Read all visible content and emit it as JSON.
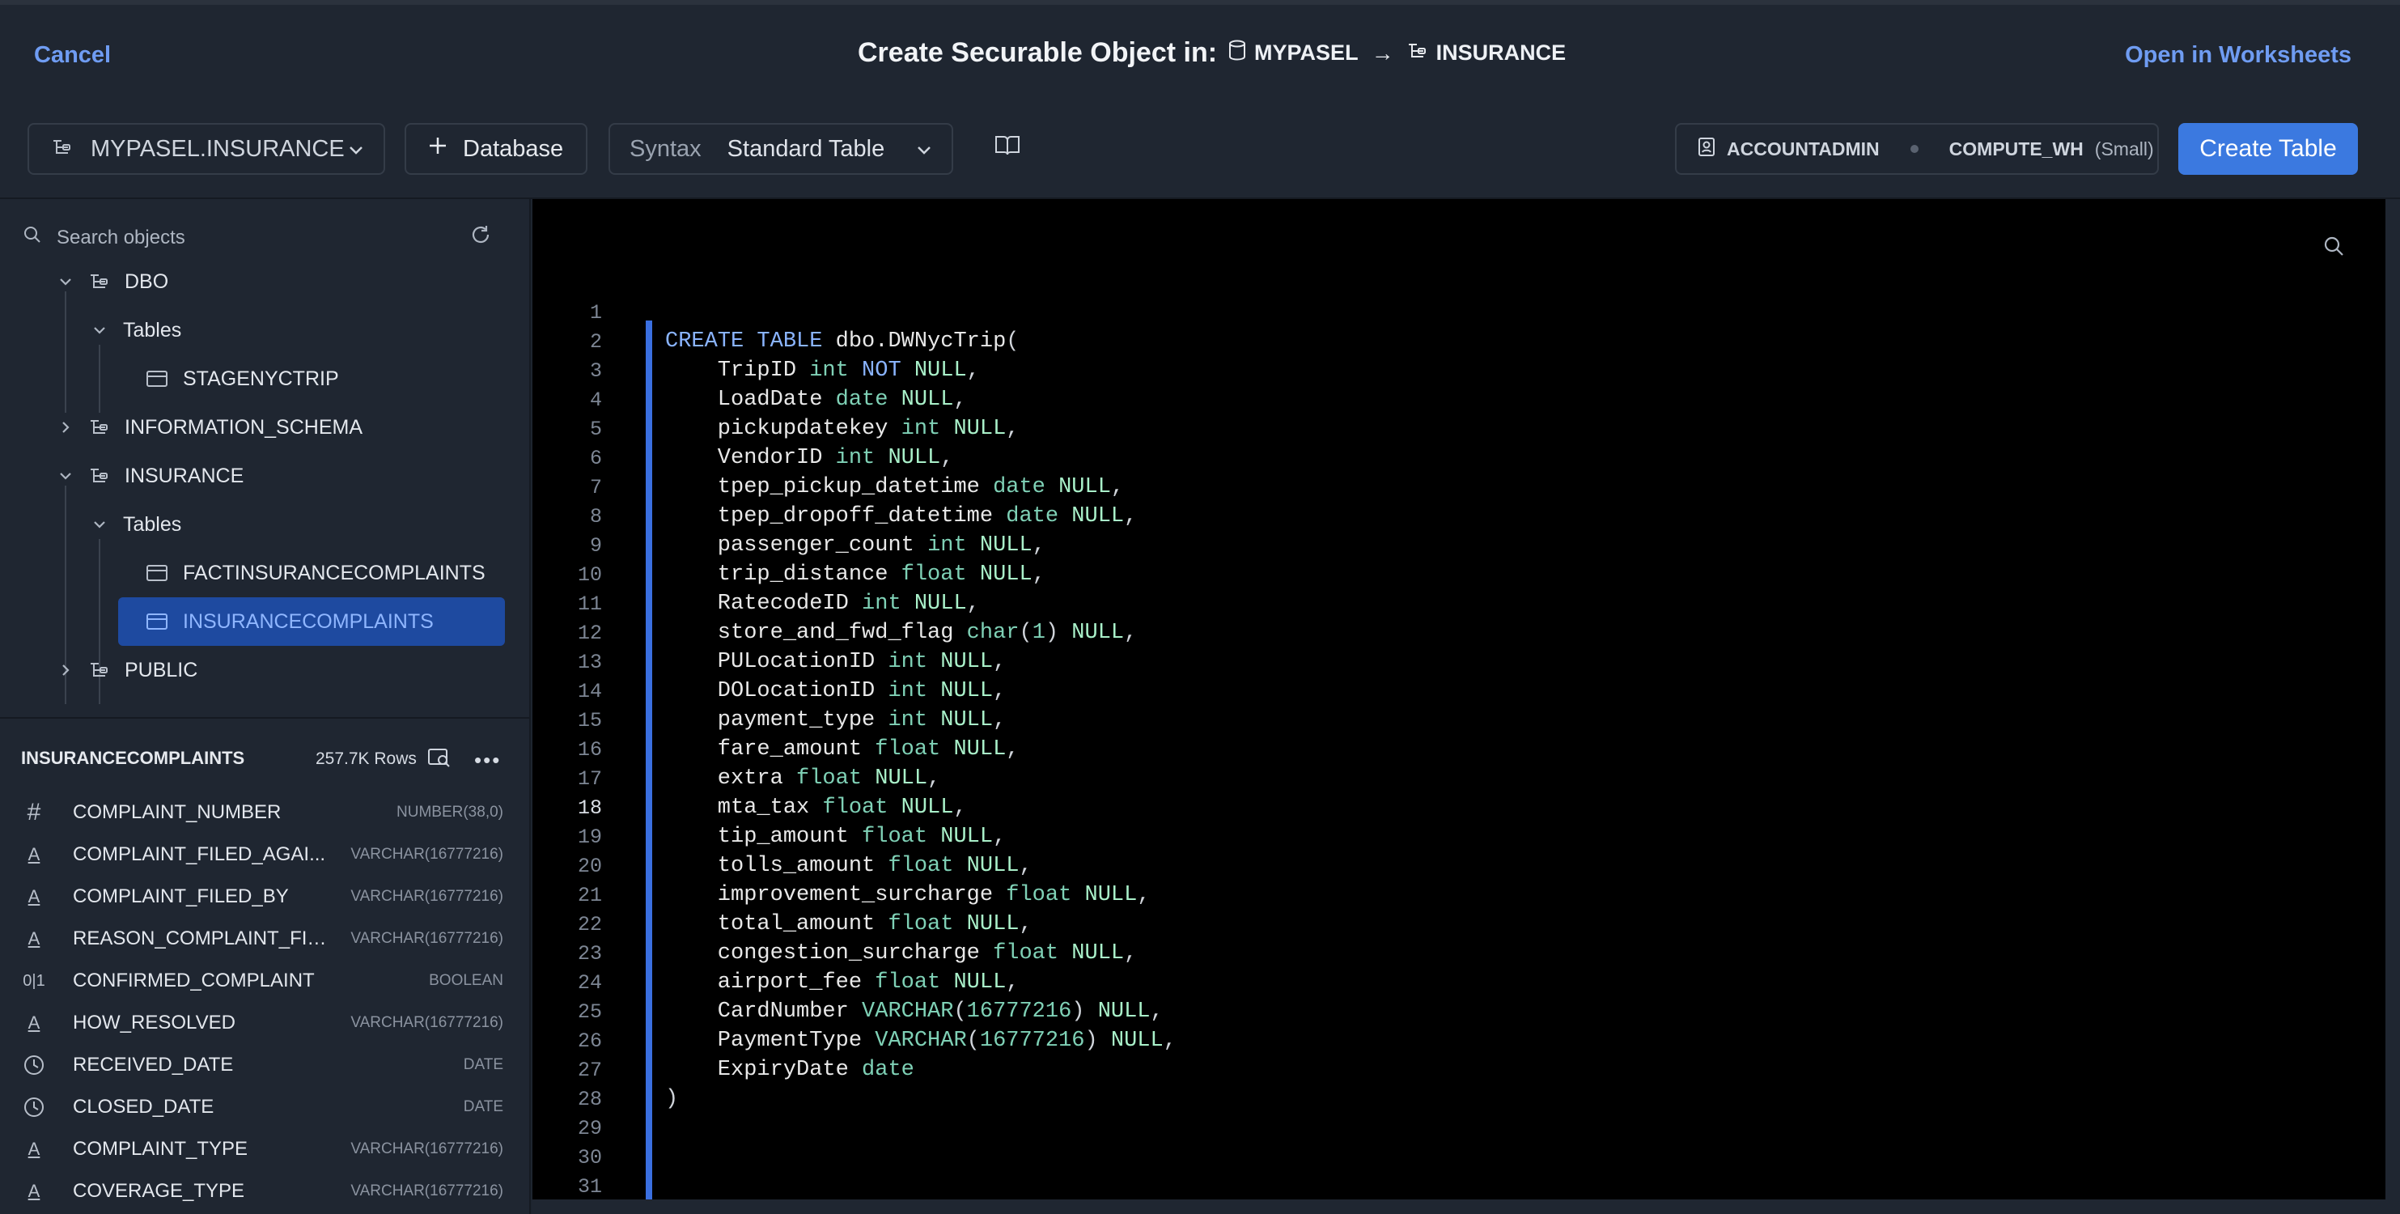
{
  "header": {
    "cancel_label": "Cancel",
    "title": "Create Securable Object in:",
    "database": "MYPASEL",
    "arrow": "→",
    "schema": "INSURANCE",
    "open_worksheets_label": "Open in Worksheets"
  },
  "toolbar": {
    "db_select_value": "MYPASEL.INSURANCE",
    "add_database_label": "Database",
    "syntax_label": "Syntax",
    "syntax_value": "Standard Table",
    "role": "ACCOUNTADMIN",
    "warehouse": "COMPUTE_WH",
    "warehouse_size": "(Small)",
    "create_label": "Create Table"
  },
  "sidebar": {
    "search_placeholder": "Search objects",
    "tree": {
      "dbo": "DBO",
      "dbo_tables": "Tables",
      "stagenyctrip": "STAGENYCTRIP",
      "information_schema": "INFORMATION_SCHEMA",
      "insurance": "INSURANCE",
      "insurance_tables": "Tables",
      "factinsurancecomplaints": "FACTINSURANCECOMPLAINTS",
      "insurancecomplaints": "INSURANCECOMPLAINTS",
      "public": "PUBLIC"
    },
    "details": {
      "table_name": "INSURANCECOMPLAINTS",
      "rows": "257.7K Rows",
      "more": "•••",
      "columns": [
        {
          "icon": "#",
          "name": "COMPLAINT_NUMBER",
          "type": "NUMBER(38,0)"
        },
        {
          "icon": "A",
          "name": "COMPLAINT_FILED_AGAI...",
          "type": "VARCHAR(16777216)"
        },
        {
          "icon": "A",
          "name": "COMPLAINT_FILED_BY",
          "type": "VARCHAR(16777216)"
        },
        {
          "icon": "A",
          "name": "REASON_COMPLAINT_FIL...",
          "type": "VARCHAR(16777216)"
        },
        {
          "icon": "0|1",
          "name": "CONFIRMED_COMPLAINT",
          "type": "BOOLEAN"
        },
        {
          "icon": "A",
          "name": "HOW_RESOLVED",
          "type": "VARCHAR(16777216)"
        },
        {
          "icon": "clock",
          "name": "RECEIVED_DATE",
          "type": "DATE"
        },
        {
          "icon": "clock",
          "name": "CLOSED_DATE",
          "type": "DATE"
        },
        {
          "icon": "A",
          "name": "COMPLAINT_TYPE",
          "type": "VARCHAR(16777216)"
        },
        {
          "icon": "A",
          "name": "COVERAGE_TYPE",
          "type": "VARCHAR(16777216)"
        }
      ]
    }
  },
  "editor": {
    "active_line": 18,
    "lines": [
      "",
      "CREATE TABLE dbo.DWNycTrip(",
      "    TripID int NOT NULL,",
      "    LoadDate date NULL,",
      "    pickupdatekey int NULL,",
      "    VendorID int NULL,",
      "    tpep_pickup_datetime date NULL,",
      "    tpep_dropoff_datetime date NULL,",
      "    passenger_count int NULL,",
      "    trip_distance float NULL,",
      "    RatecodeID int NULL,",
      "    store_and_fwd_flag char(1) NULL,",
      "    PULocationID int NULL,",
      "    DOLocationID int NULL,",
      "    payment_type int NULL,",
      "    fare_amount float NULL,",
      "    extra float NULL,",
      "    mta_tax float NULL,",
      "    tip_amount float NULL,",
      "    tolls_amount float NULL,",
      "    improvement_surcharge float NULL,",
      "    total_amount float NULL,",
      "    congestion_surcharge float NULL,",
      "    airport_fee float NULL,",
      "    CardNumber VARCHAR(16777216) NULL,",
      "    PaymentType VARCHAR(16777216) NULL,",
      "    ExpiryDate date",
      ")",
      "",
      "",
      ""
    ]
  },
  "colors": {
    "accent": "#3b79e0",
    "link": "#6f9cf2",
    "selected_bg": "#1e4aa0",
    "keyword": "#8ab4ff",
    "type": "#7fd1b6"
  }
}
